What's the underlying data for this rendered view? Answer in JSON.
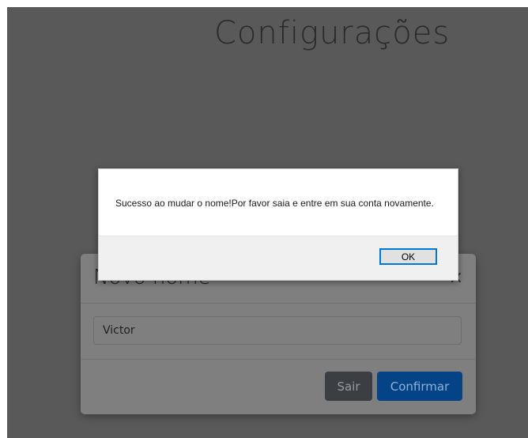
{
  "page": {
    "title": "Configurações"
  },
  "modal": {
    "title": "Novo nome",
    "close_symbol": "×",
    "name_value": "Victor",
    "exit_label": "Sair",
    "confirm_label": "Confirmar"
  },
  "alert": {
    "message": "Sucesso ao mudar o nome!Por favor saia e entre em sua conta novamente.",
    "ok_label": "OK"
  },
  "colors": {
    "backdrop": "#595959",
    "confirm_button": "#034386",
    "exit_button": "#3b3e42",
    "alert_focus": "#0078d7"
  }
}
